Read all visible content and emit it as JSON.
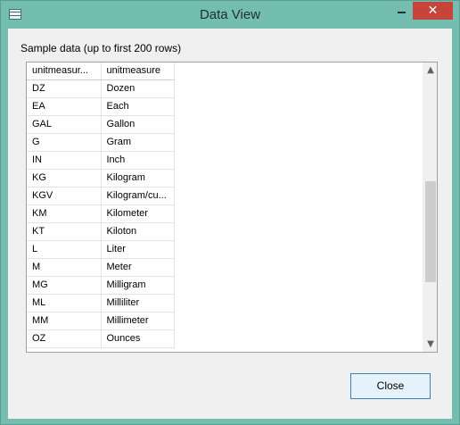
{
  "window": {
    "title": "Data View",
    "close_glyph": "✕"
  },
  "caption": "Sample data (up to first 200 rows)",
  "grid": {
    "headers": [
      "unitmeasur...",
      "unitmeasure"
    ],
    "rows": [
      [
        "DZ",
        "Dozen"
      ],
      [
        "EA",
        "Each"
      ],
      [
        "GAL",
        "Gallon"
      ],
      [
        "G",
        "Gram"
      ],
      [
        "IN",
        "Inch"
      ],
      [
        "KG",
        "Kilogram"
      ],
      [
        "KGV",
        "Kilogram/cu..."
      ],
      [
        "KM",
        "Kilometer"
      ],
      [
        "KT",
        "Kiloton"
      ],
      [
        "L",
        "Liter"
      ],
      [
        "M",
        "Meter"
      ],
      [
        "MG",
        "Milligram"
      ],
      [
        "ML",
        "Milliliter"
      ],
      [
        "MM",
        "Millimeter"
      ],
      [
        "OZ",
        "Ounces"
      ]
    ],
    "scroll_up_glyph": "▲",
    "scroll_down_glyph": "▼"
  },
  "buttons": {
    "close_label": "Close"
  },
  "colors": {
    "titlebar": "#73bdb1",
    "close_button": "#c7443a",
    "focus_border": "#3c7fb1"
  },
  "icons": [
    "app-table-icon",
    "minimize-icon",
    "close-icon",
    "scroll-up-icon",
    "scroll-down-icon"
  ]
}
